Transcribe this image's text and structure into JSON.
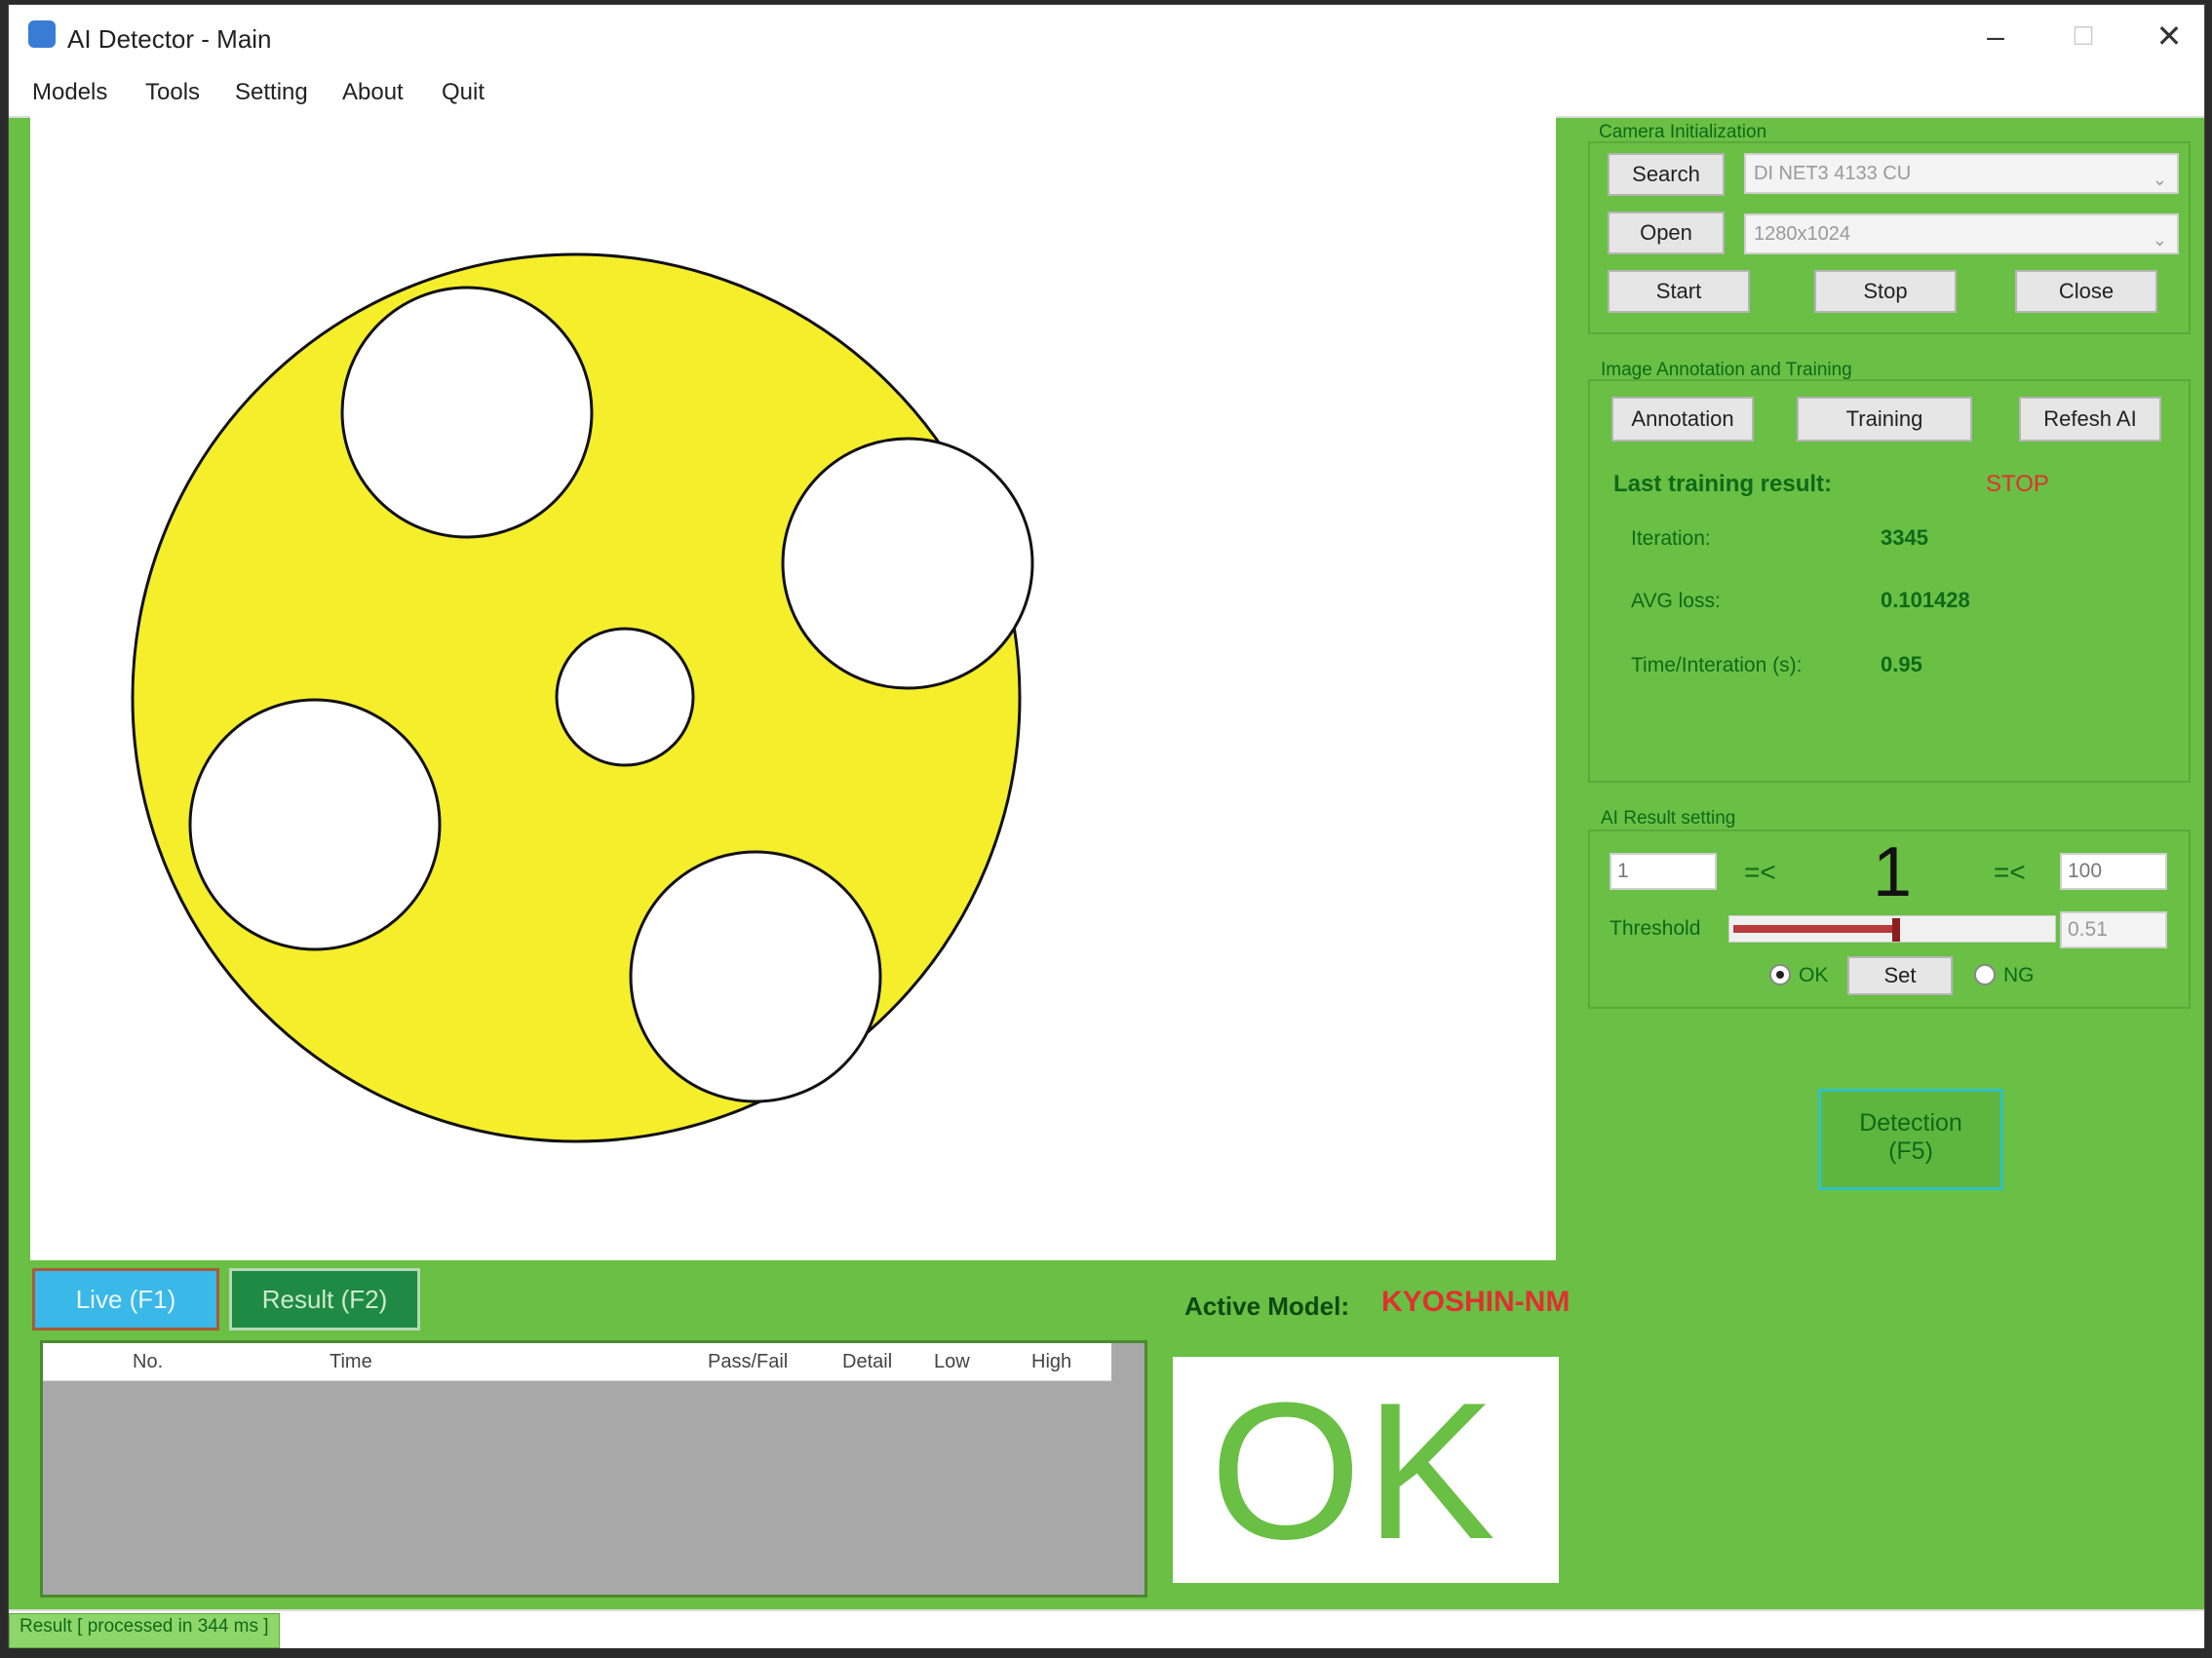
{
  "window": {
    "title": "AI Detector - Main",
    "minimize_icon": "minimize-icon",
    "maximize_icon": "maximize-icon",
    "close_icon": "close-icon"
  },
  "menu": [
    "Models",
    "Tools",
    "Setting",
    "About",
    "Quit"
  ],
  "camera_init": {
    "title": "Camera Initialization",
    "search_label": "Search",
    "open_label": "Open",
    "start_label": "Start",
    "stop_label": "Stop",
    "close_label": "Close",
    "camera_value": "DI NET3 4133 CU",
    "resolution_value": "1280x1024"
  },
  "training": {
    "title": "Image Annotation and Training",
    "annotation_label": "Annotation",
    "training_label": "Training",
    "refresh_label": "Refesh AI",
    "last_result_label": "Last training result:",
    "last_result_status": "STOP",
    "iteration_label": "Iteration:",
    "iteration_value": "3345",
    "avg_loss_label": "AVG loss:",
    "avg_loss_value": "0.101428",
    "time_label": "Time/Interation (s):",
    "time_value": "0.95"
  },
  "ai_result": {
    "title": "AI Result setting",
    "low_value": "1",
    "le1": "=<",
    "center_value": "1",
    "le2": "=<",
    "high_value": "100",
    "threshold_label": "Threshold",
    "threshold_value": "0.51",
    "threshold_fraction": 0.51,
    "ok_label": "OK",
    "set_label": "Set",
    "ng_label": "NG"
  },
  "detection": {
    "label_line1": "Detection",
    "label_line2": "(F5)"
  },
  "tabs": {
    "live": "Live (F1)",
    "result": "Result (F2)"
  },
  "active_model": {
    "label": "Active Model:",
    "value": "KYOSHIN-NM"
  },
  "table": {
    "columns": [
      "No.",
      "Time",
      "Pass/Fail",
      "Detail",
      "Low",
      "High"
    ]
  },
  "result_text": "OK",
  "status": "Result [ processed in 344 ms ]",
  "colors": {
    "background_green": "#6abf45",
    "part_yellow": "#f5ee2b",
    "live_tab": "#3ab8e8",
    "result_tab": "#1e8a44",
    "status_red": "#e03030"
  }
}
